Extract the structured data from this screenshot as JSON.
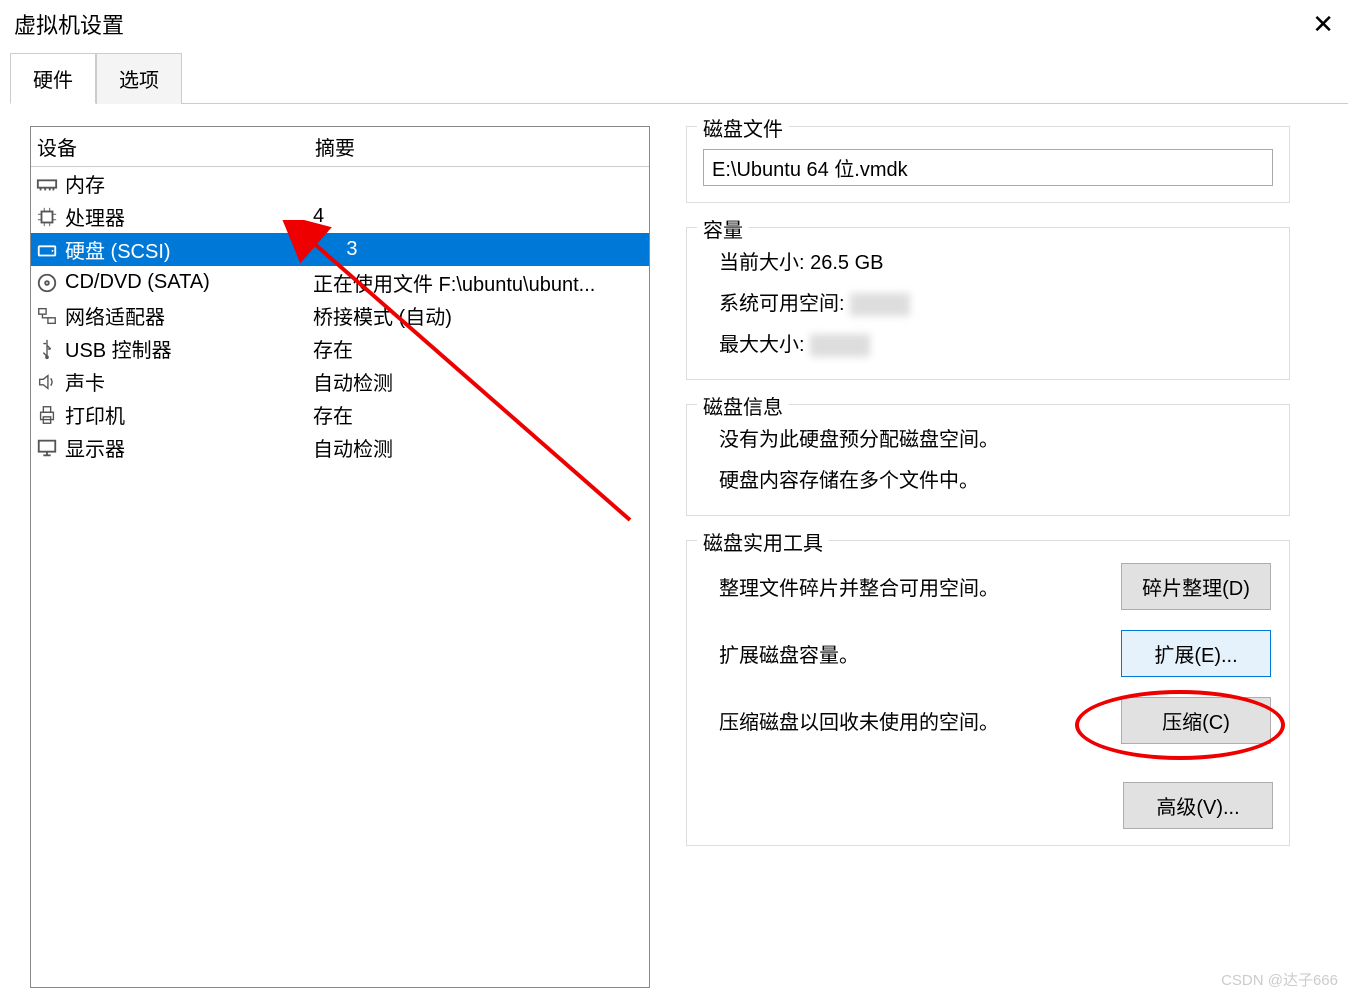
{
  "window": {
    "title": "虚拟机设置"
  },
  "tabs": {
    "hardware": "硬件",
    "options": "选项"
  },
  "device_table": {
    "header_device": "设备",
    "header_summary": "摘要",
    "rows": {
      "memory": {
        "name": "内存",
        "summary": ""
      },
      "processor": {
        "name": "处理器",
        "summary": "4"
      },
      "disk": {
        "name": "硬盘 (SCSI)",
        "summary": "3"
      },
      "cddvd": {
        "name": "CD/DVD (SATA)",
        "summary": "正在使用文件 F:\\ubuntu\\ubunt..."
      },
      "network": {
        "name": "网络适配器",
        "summary": "桥接模式 (自动)"
      },
      "usb": {
        "name": "USB 控制器",
        "summary": "存在"
      },
      "sound": {
        "name": "声卡",
        "summary": "自动检测"
      },
      "printer": {
        "name": "打印机",
        "summary": "存在"
      },
      "display": {
        "name": "显示器",
        "summary": "自动检测"
      }
    }
  },
  "right": {
    "diskfile": {
      "title": "磁盘文件",
      "value": "E:\\Ubuntu 64 位.vmdk"
    },
    "capacity": {
      "title": "容量",
      "current_label": "当前大小:",
      "current_value": "26.5 GB",
      "free_label": "系统可用空间:",
      "free_value": "",
      "max_label": "最大大小:",
      "max_value": ""
    },
    "diskinfo": {
      "title": "磁盘信息",
      "line1": "没有为此硬盘预分配磁盘空间。",
      "line2": "硬盘内容存储在多个文件中。"
    },
    "utilities": {
      "title": "磁盘实用工具",
      "defrag_desc": "整理文件碎片并整合可用空间。",
      "defrag_btn": "碎片整理(D)",
      "expand_desc": "扩展磁盘容量。",
      "expand_btn": "扩展(E)...",
      "compact_desc": "压缩磁盘以回收未使用的空间。",
      "compact_btn": "压缩(C)",
      "advanced_btn": "高级(V)..."
    }
  },
  "watermark": "CSDN @达子666"
}
